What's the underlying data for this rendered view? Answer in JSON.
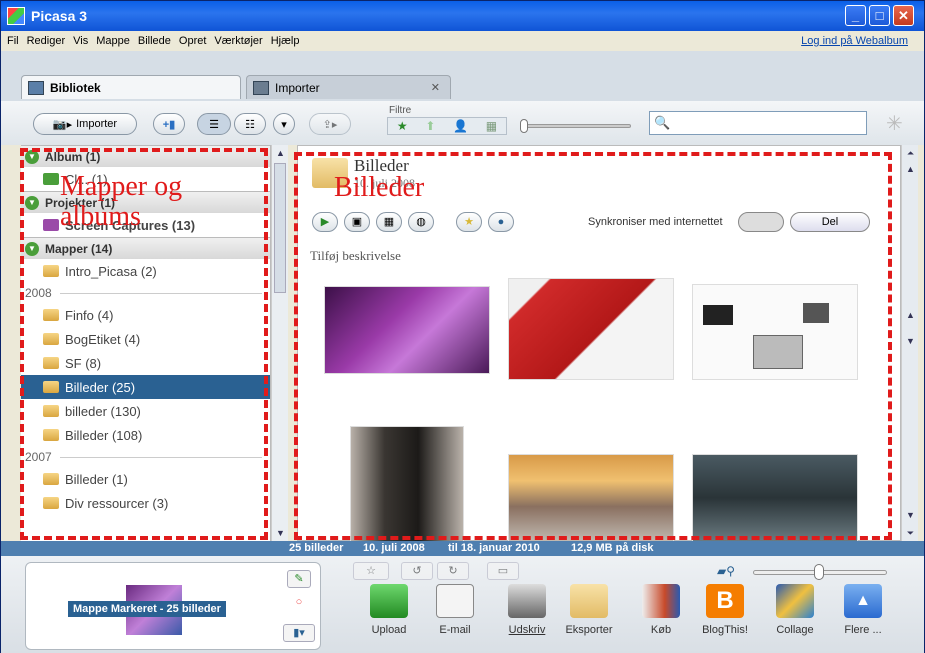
{
  "titlebar": {
    "title": "Picasa 3"
  },
  "menu": {
    "items": [
      "Fil",
      "Rediger",
      "Vis",
      "Mappe",
      "Billede",
      "Opret",
      "Værktøjer",
      "Hjælp"
    ],
    "login": "Log ind på Webalbum"
  },
  "tabs": [
    {
      "label": "Bibliotek"
    },
    {
      "label": "Importer"
    }
  ],
  "toolbar": {
    "import_label": "Importer",
    "filter_label": "Filtre"
  },
  "search": {
    "placeholder": ""
  },
  "sidebar": {
    "album_header": "Album (1)",
    "album_item": "Cl... (1)",
    "projects_header": "Projekter (1)",
    "projects_item": "Screen Captures (13)",
    "folders_header": "Mapper (14)",
    "folder_intro": "Intro_Picasa (2)",
    "year_2008": "2008",
    "folder_finfo": "Finfo (4)",
    "folder_bogetiket": "BogEtiket (4)",
    "folder_sf": "SF (8)",
    "folder_billeder25": "Billeder (25)",
    "folder_billeder130": "billeder (130)",
    "folder_billeder108": "Billeder (108)",
    "year_2007": "2007",
    "folder_billeder1": "Billeder (1)",
    "folder_divres": "Div ressourcer (3)"
  },
  "main": {
    "title": "Billeder",
    "date": "10. juli 2008",
    "sync_label": "Synkroniser med internettet",
    "share_label": "Del",
    "add_description": "Tilføj beskrivelse"
  },
  "status": {
    "count": "25 billeder",
    "date1": "10. juli 2008",
    "date2": "til 18. januar 2010",
    "size": "12,9 MB på disk"
  },
  "tray": {
    "label": "Mappe Markeret - 25 billeder"
  },
  "actions": [
    {
      "label": "Upload"
    },
    {
      "label": "E-mail"
    },
    {
      "label": "Udskriv"
    },
    {
      "label": "Eksporter"
    },
    {
      "label": "Køb"
    },
    {
      "label": "BlogThis!"
    },
    {
      "label": "Collage"
    },
    {
      "label": "Flere ..."
    }
  ],
  "annotations": {
    "left": "Mapper og albums",
    "right": "Billeder"
  },
  "colors": {
    "titlebar": "#0a5fe8",
    "selected": "#2a6192",
    "annotation": "#e01b1b"
  }
}
